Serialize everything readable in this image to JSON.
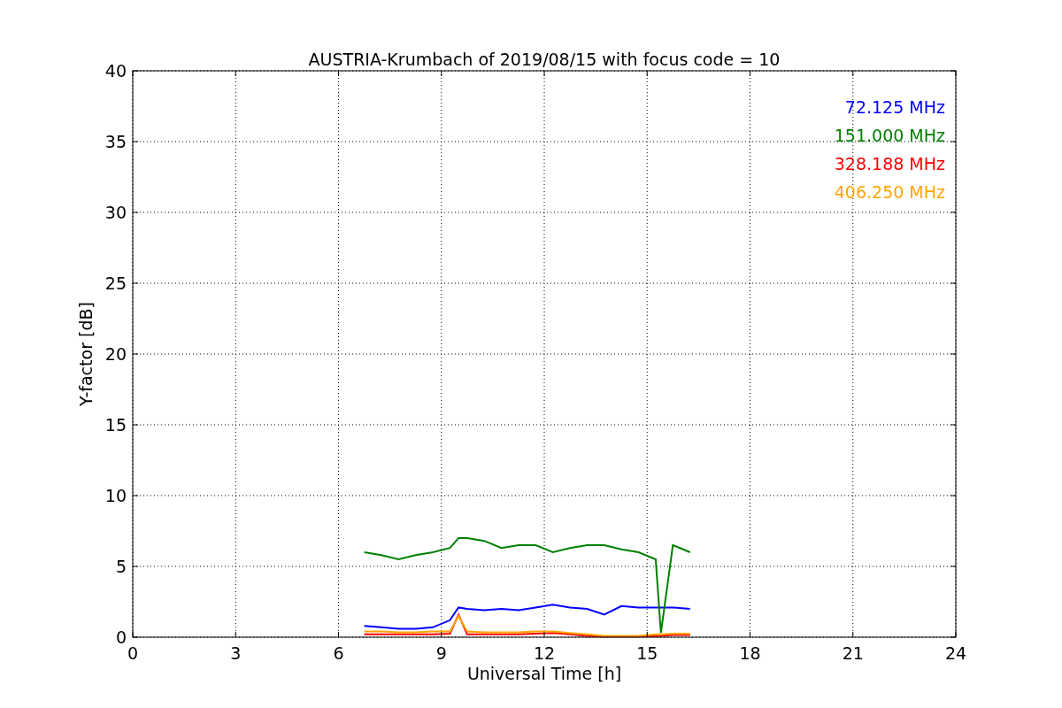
{
  "chart_data": {
    "type": "line",
    "title": "AUSTRIA-Krumbach of 2019/08/15 with focus code = 10",
    "xlabel": "Universal Time [h]",
    "ylabel": "Y-factor [dB]",
    "x": [
      6.75,
      7.25,
      7.75,
      8.25,
      8.75,
      9.25,
      9.5,
      9.75,
      10.25,
      10.75,
      11.25,
      11.75,
      12.25,
      12.75,
      13.25,
      13.75,
      14.25,
      14.75,
      15.25,
      15.4,
      15.75,
      16.25
    ],
    "series": [
      {
        "name": "72.125 MHz",
        "color": "#0000ff",
        "values": [
          0.8,
          0.7,
          0.6,
          0.6,
          0.7,
          1.2,
          2.1,
          2.0,
          1.9,
          2.0,
          1.9,
          2.1,
          2.3,
          2.1,
          2.0,
          1.6,
          2.2,
          2.1,
          2.1,
          2.1,
          2.1,
          2.0
        ]
      },
      {
        "name": "151.000 MHz",
        "color": "#008000",
        "values": [
          6.0,
          5.8,
          5.5,
          5.8,
          6.0,
          6.3,
          7.0,
          7.0,
          6.8,
          6.3,
          6.5,
          6.5,
          6.0,
          6.3,
          6.5,
          6.5,
          6.2,
          6.0,
          5.5,
          0.3,
          6.5,
          6.0
        ]
      },
      {
        "name": "328.188 MHz",
        "color": "#ff0000",
        "values": [
          0.2,
          0.2,
          0.2,
          0.2,
          0.2,
          0.25,
          1.6,
          0.2,
          0.2,
          0.2,
          0.2,
          0.25,
          0.3,
          0.2,
          0.1,
          0.05,
          0.05,
          0.05,
          0.1,
          0.1,
          0.15,
          0.15
        ]
      },
      {
        "name": "406.250 MHz",
        "color": "#ffa500",
        "values": [
          0.4,
          0.4,
          0.35,
          0.35,
          0.4,
          0.4,
          1.5,
          0.4,
          0.35,
          0.35,
          0.35,
          0.4,
          0.4,
          0.3,
          0.2,
          0.1,
          0.1,
          0.1,
          0.2,
          0.2,
          0.25,
          0.25
        ]
      }
    ],
    "grid": true,
    "xlim": [
      0,
      24
    ],
    "ylim": [
      0,
      40
    ],
    "xticks": [
      0,
      3,
      6,
      9,
      12,
      15,
      18,
      21,
      24
    ],
    "yticks": [
      0,
      5,
      10,
      15,
      20,
      25,
      30,
      35,
      40
    ]
  }
}
